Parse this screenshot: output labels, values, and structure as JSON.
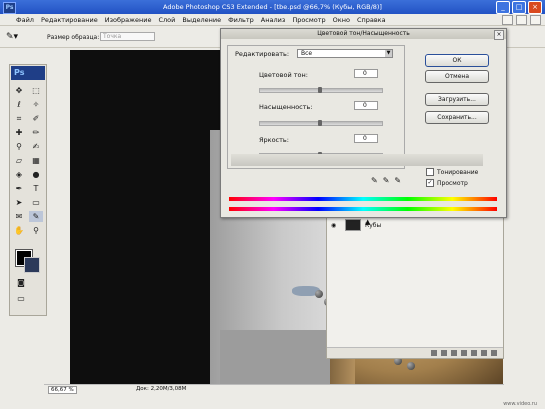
{
  "app": {
    "logo": "Ps",
    "title": "Adobe Photoshop CS3 Extended - [tbe.psd @66,7% (Кубы, RGB/8)]"
  },
  "menu": [
    "Файл",
    "Редактирование",
    "Изображение",
    "Слой",
    "Выделение",
    "Фильтр",
    "Анализ",
    "Просмотр",
    "Окно",
    "Справка"
  ],
  "options_bar": {
    "sample_label": "Размер образца:",
    "sample_value": "Точка"
  },
  "dialog": {
    "title": "Цветовой тон/Насыщенность",
    "edit_label": "Редактировать:",
    "edit_value": "Все",
    "hue_label": "Цветовой тон:",
    "hue_value": "0",
    "saturation_label": "Насыщенность:",
    "saturation_value": "0",
    "lightness_label": "Яркость:",
    "lightness_value": "0",
    "ok": "ОК",
    "cancel": "Отмена",
    "load": "Загрузить...",
    "save": "Сохранить...",
    "colorize": "Тонирование",
    "preview": "Просмотр",
    "preview_checked": true,
    "colorize_checked": false
  },
  "layers": {
    "layer_name": "Кубы"
  },
  "status": {
    "zoom": "66,67 %",
    "doc_info": "Док: 2,20M/3,08M"
  },
  "watermark": "www.video.ru"
}
